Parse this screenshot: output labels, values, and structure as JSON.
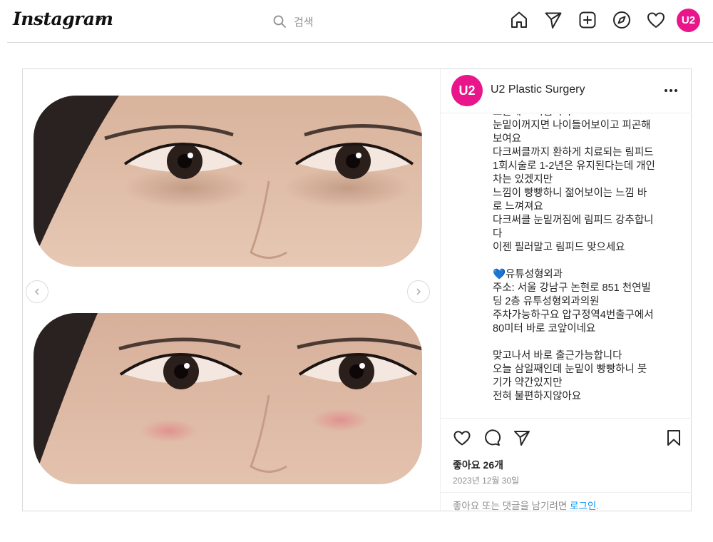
{
  "header": {
    "logo_text": "Instagram",
    "search_placeholder": "검색",
    "avatar_text": "U2"
  },
  "nav_icons": [
    "home-icon",
    "send-icon",
    "new-post-icon",
    "explore-icon",
    "heart-icon",
    "profile-avatar"
  ],
  "colors": {
    "brand": "#e8168a",
    "link": "#0095f6",
    "muted": "#8e8e8e",
    "border": "#dbdbdb"
  },
  "post": {
    "account": {
      "name": "U2 Plastic Surgery",
      "avatar_text": "U2"
    },
    "caption_lines": [
      "르는게 느껴집니다",
      "눈밑이꺼지면 나이들어보이고 피곤해",
      "보여요",
      "다크써클까지 환하게 치료되는 림피드",
      "1회시술로 1-2년은 유지된다는데 개인",
      "차는 있겠지만",
      "느낌이 빵빵하니 젊어보이는 느낌 바",
      "로 느껴져요",
      "다크써클 눈밑꺼짐에 림피드 강추합니",
      "다",
      "이젠 필러말고 림피드 맞으세요",
      "",
      "💙유튜성형외과",
      "주소: 서울 강남구 논현로 851 천연빌",
      "딩 2층 유투성형외과의원",
      "주차가능하구요 압구정역4번출구에서",
      "80미터 바로 코앞이네요",
      "",
      "맞고나서 바로 출근가능합니다",
      "오늘 삼일째인데 눈밑이 빵빵하니 붓",
      "기가 약간있지만",
      "전혀 불편하지않아요"
    ],
    "likes": "좋아요 26개",
    "date": "2023년 12월 30일",
    "login_prompt": "좋아요 또는 댓글을 남기려면 ",
    "login_link": "로그인",
    "login_suffix": ".",
    "action_icons": [
      "like-icon",
      "comment-icon",
      "share-icon",
      "save-icon"
    ]
  }
}
